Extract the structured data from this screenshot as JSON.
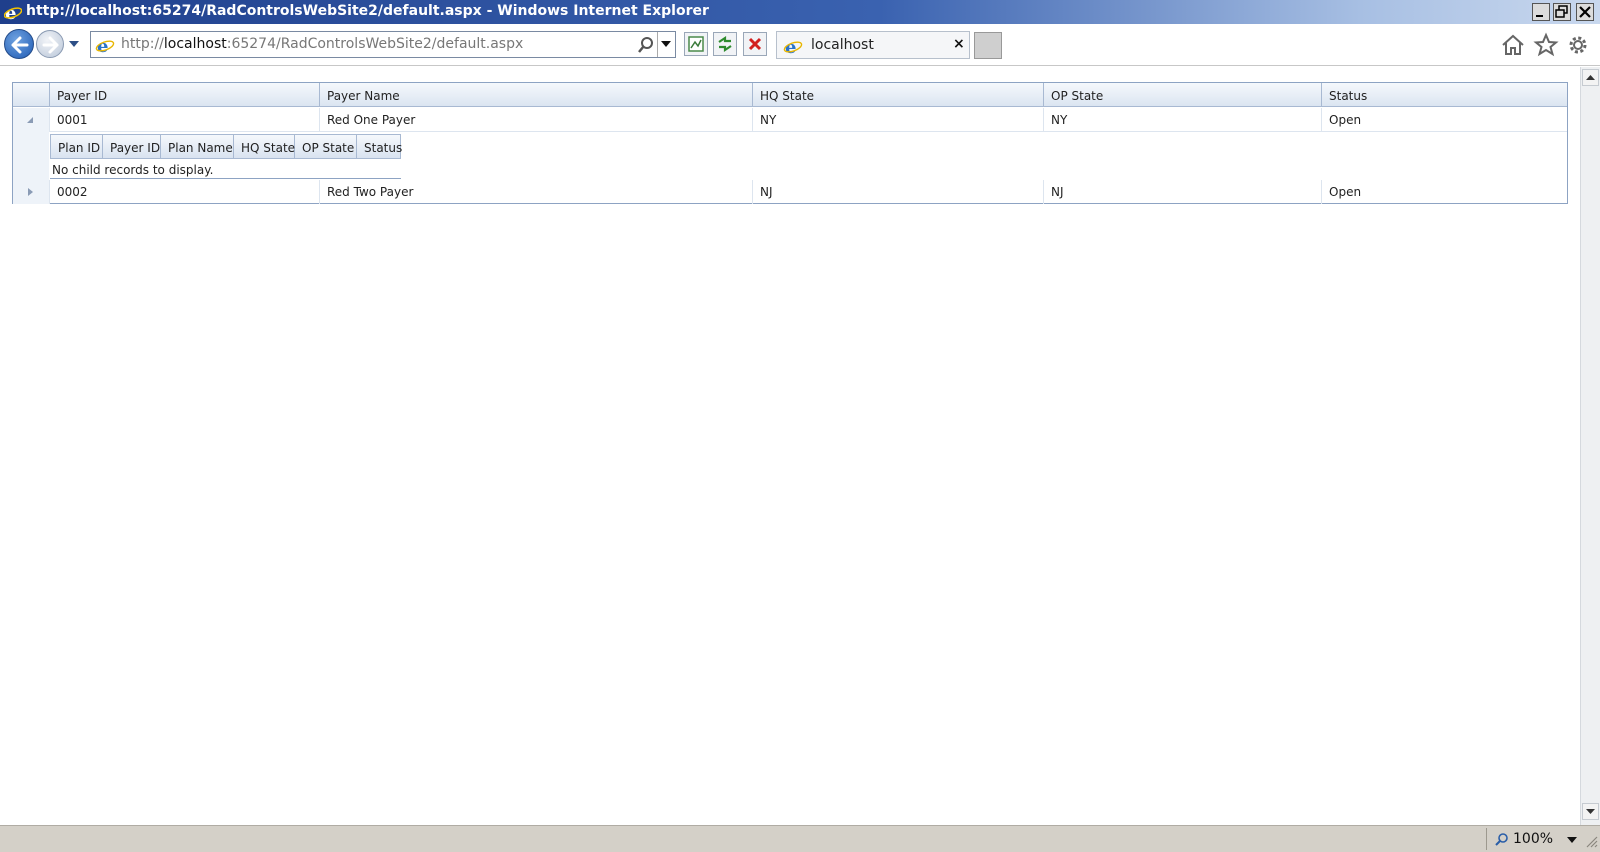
{
  "window": {
    "title": "http://localhost:65274/RadControlsWebSite2/default.aspx - Windows Internet Explorer"
  },
  "address_bar": {
    "prefix": "http://",
    "host": "localhost",
    "rest": ":65274/RadControlsWebSite2/default.aspx"
  },
  "tab": {
    "label": "localhost",
    "close": "×"
  },
  "grid": {
    "columns": [
      "Payer ID",
      "Payer Name",
      "HQ State",
      "OP State",
      "Status"
    ],
    "rows": [
      {
        "payer_id": "0001",
        "payer_name": "Red One Payer",
        "hq_state": "NY",
        "op_state": "NY",
        "status": "Open",
        "expanded": true
      },
      {
        "payer_id": "0002",
        "payer_name": "Red Two Payer",
        "hq_state": "NJ",
        "op_state": "NJ",
        "status": "Open",
        "expanded": false
      }
    ],
    "detail": {
      "columns": [
        "Plan ID",
        "Payer ID",
        "Plan Name",
        "HQ State",
        "OP State",
        "Status"
      ],
      "no_records": "No child records to display."
    }
  },
  "statusbar": {
    "zoom": "100%"
  },
  "colors": {
    "titlebar": "#1f3f8c",
    "grid_border": "#8da3c3",
    "header_bg": "#dbe5f1"
  }
}
